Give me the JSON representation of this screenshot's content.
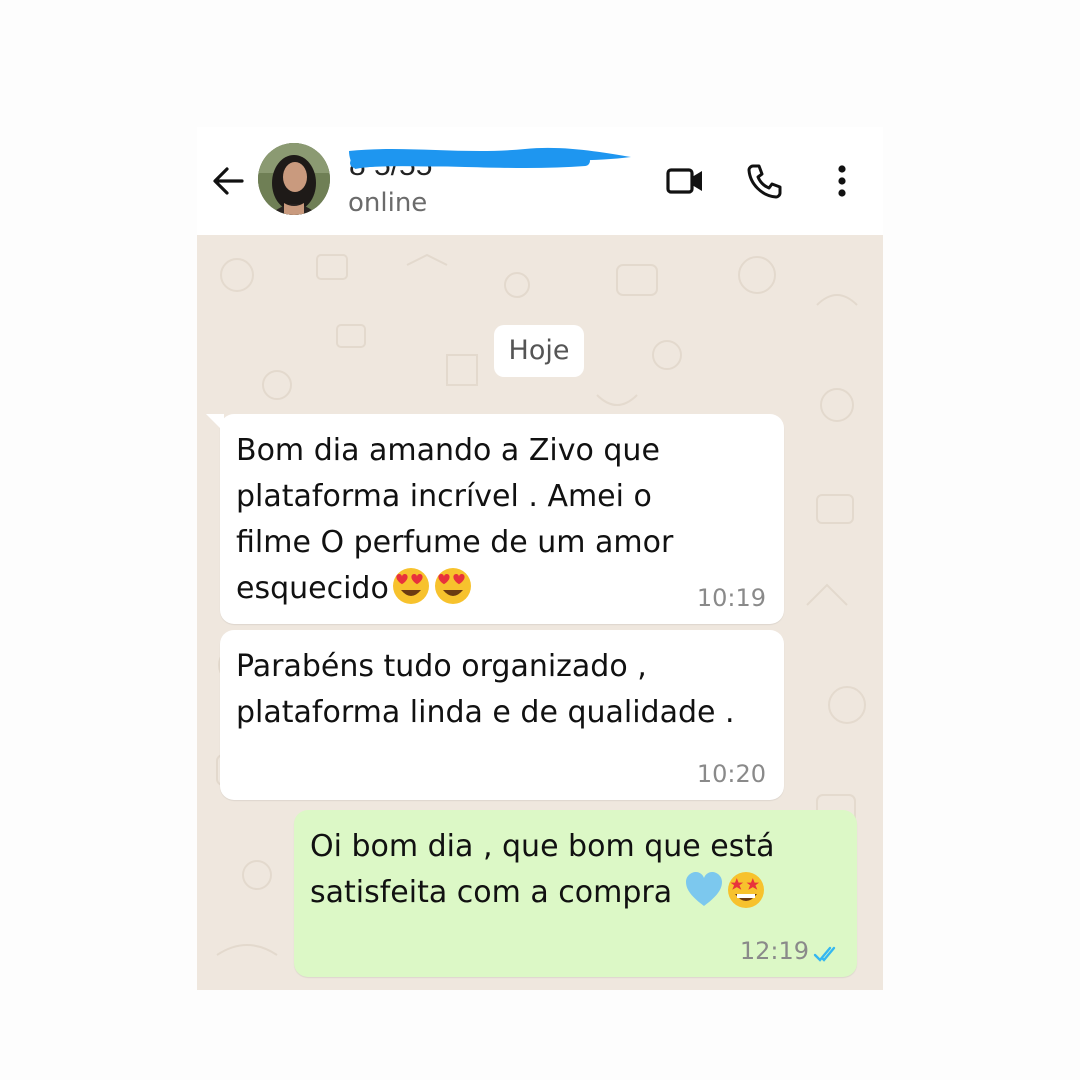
{
  "header": {
    "contact_name": "",
    "status": "online",
    "icons": [
      "arrow-left-icon",
      "video-camera-icon",
      "phone-icon",
      "more-vertical-icon"
    ]
  },
  "chat": {
    "date_separator": "Hoje",
    "messages": [
      {
        "direction": "incoming",
        "text": "Bom dia amando a Zivo que\nplataforma incrível . Amei o\nfilme  O perfume de um amor\nesquecido",
        "emojis": [
          "heart-eyes-emoji",
          "heart-eyes-emoji"
        ],
        "time": "10:19"
      },
      {
        "direction": "incoming",
        "text": "Parabéns tudo organizado ,\nplataforma linda e de qualidade .",
        "emojis": [],
        "time": "10:20"
      },
      {
        "direction": "outgoing",
        "text": "Oi bom dia , que bom que está\nsatisfeita com a compra",
        "emojis": [
          "blue-heart-emoji",
          "star-struck-emoji"
        ],
        "time": "12:19",
        "read_receipt": "double-check-blue"
      }
    ]
  },
  "colors": {
    "chat_background": "#efe7de",
    "incoming_bubble": "#ffffff",
    "outgoing_bubble": "#dcf8c6",
    "redaction": "#1e96f0",
    "read_tick": "#34b7f1"
  }
}
